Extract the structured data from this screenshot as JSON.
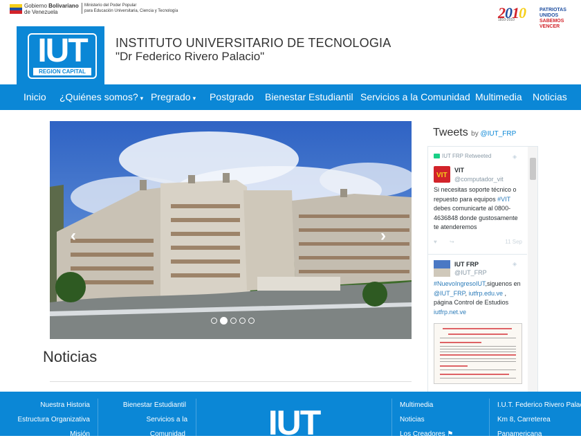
{
  "gov": {
    "line1_a": "Gobierno ",
    "line1_b": "Bolivariano",
    "line2": "de Venezuela",
    "ministry_line1": "Ministerio del Poder Popular",
    "ministry_line2": "para Educación Universitaria, Ciencia y Tecnología",
    "flag_colors": [
      "#f6cf1a",
      "#1f4fa0",
      "#d2232a"
    ]
  },
  "bicentenario": {
    "num_a": "2",
    "num_b": "0",
    "num_c": "1",
    "num_d": "0",
    "years": "1810-2010",
    "slogan_1": "PATRIOTAS UNIDOS",
    "slogan_2": "SABEMOS VENCER"
  },
  "logo": {
    "text": "IUT",
    "sub": "REGION CAPITAL"
  },
  "header": {
    "name": "INSTITUTO UNIVERSITARIO DE TECNOLOGIA",
    "subtitle": "\"Dr Federico Rivero Palacio\""
  },
  "nav": {
    "items": [
      {
        "label": "Inicio"
      },
      {
        "label": "¿Quiénes somos?"
      },
      {
        "label": "Pregrado"
      },
      {
        "label": "Postgrado"
      },
      {
        "label": "Bienestar Estudiantil"
      },
      {
        "label": "Servicios a la Comunidad"
      },
      {
        "label": "Multimedia"
      },
      {
        "label": "Noticias"
      }
    ],
    "caret": "▾"
  },
  "carousel": {
    "prev": "‹",
    "next": "›",
    "slide_count": 5,
    "active_slide": 2
  },
  "news": {
    "title": "Noticias"
  },
  "twitter": {
    "title": "Tweets",
    "by": "by ",
    "by_handle": "@IUT_FRP",
    "retweet_label": "IUT FRP Retweeted",
    "tweet1": {
      "name": "VIT",
      "handle": "@computador_vit",
      "body_1": "Si necesitas soporte técnico o repuesto para equipos ",
      "body_link": "#VIT",
      "body_2": " debes comunicarte al 0800-4636848 donde gustosamente te atenderemos",
      "date": "11 Sep"
    },
    "tweet2": {
      "name": "IUT FRP",
      "handle": "@IUT_FRP",
      "link1": "#NuevoIngresoIUT",
      "body_1": ",siguenos en ",
      "link2": "@IUT_FRP",
      "body_2": ", ",
      "link3": "iutfrp.edu.ve",
      "body_3": " , página Control de Estudios ",
      "link4": "iutfrp.net.ve"
    },
    "accent": "#2b7bb9"
  },
  "footer": {
    "col1": [
      "Nuestra Historia",
      "Estructura Organizativa",
      "Misión"
    ],
    "col2": [
      "Bienestar Estudiantil",
      "Servicios a la",
      "Comunidad"
    ],
    "logo_text": "IUT",
    "col3": [
      "Multimedia",
      "Noticias",
      "Los Creadores"
    ],
    "col4": [
      "I.U.T. Federico Rivero Palacio,",
      "Km 8, Carreterea",
      "Panamericana"
    ]
  },
  "colors": {
    "brand_blue": "#0b87d6"
  }
}
